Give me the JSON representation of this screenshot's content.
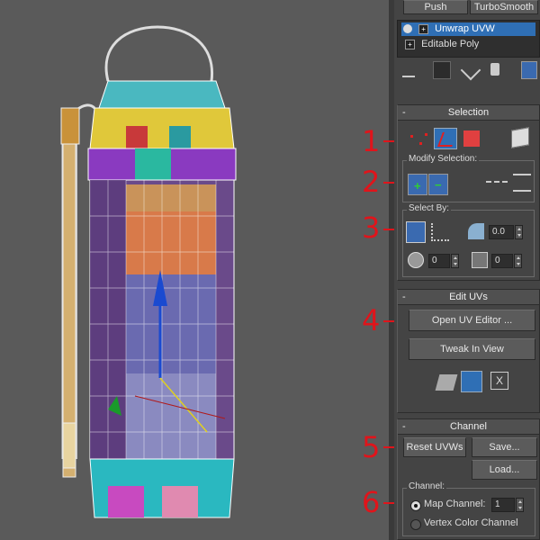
{
  "viewport": {
    "label": "3D viewport - extinguisher model"
  },
  "top_buttons": {
    "push": "Push",
    "turbosmooth": "TurboSmooth"
  },
  "stack": {
    "items": [
      {
        "label": "Unwrap UVW",
        "selected": true
      },
      {
        "label": "Editable Poly",
        "selected": false
      }
    ]
  },
  "selection": {
    "title": "Selection",
    "modify_label": "Modify Selection:",
    "select_by_label": "Select By:",
    "angle_value": "0.0",
    "spin1": "0",
    "spin2": "0"
  },
  "edit_uvs": {
    "title": "Edit UVs",
    "open_editor": "Open UV Editor ...",
    "tweak": "Tweak In View"
  },
  "channel": {
    "title": "Channel",
    "reset": "Reset UVWs",
    "save": "Save...",
    "load": "Load...",
    "group_label": "Channel:",
    "map_channel": "Map Channel:",
    "map_channel_value": "1",
    "vertex_color": "Vertex Color Channel"
  },
  "callouts": [
    "1",
    "2",
    "3",
    "4",
    "5",
    "6"
  ],
  "colors": {
    "accent": "#e0141b",
    "selected": "#2f6fb5"
  }
}
